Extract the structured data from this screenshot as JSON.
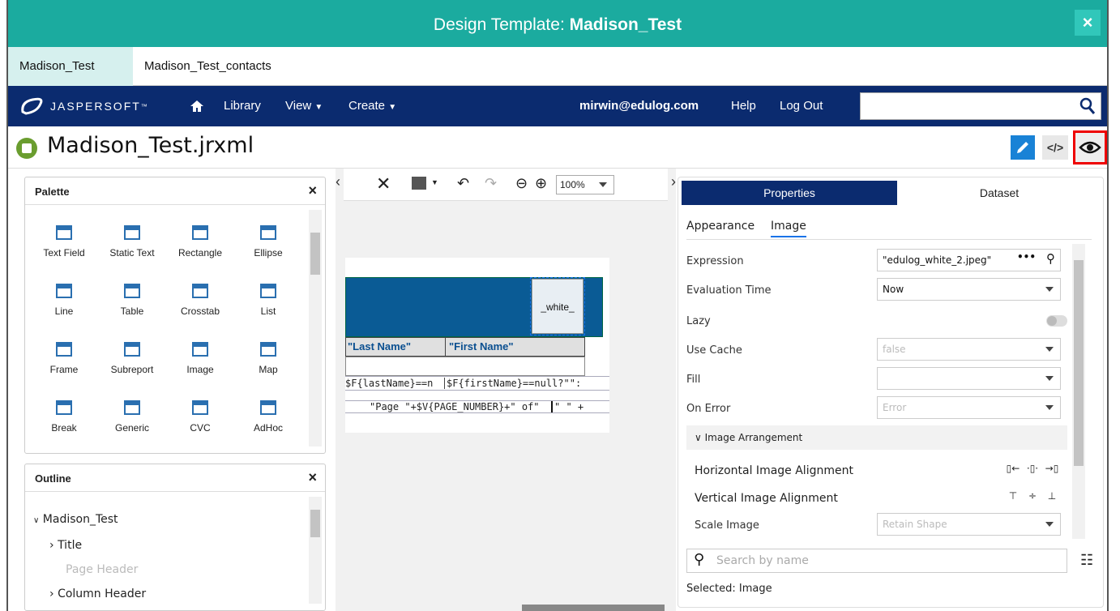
{
  "dialog": {
    "title_prefix": "Design Template: ",
    "title_name": "Madison_Test",
    "close": "×"
  },
  "tabs": [
    {
      "label": "Madison_Test",
      "active": true
    },
    {
      "label": "Madison_Test_contacts",
      "active": false
    }
  ],
  "nav": {
    "logo": "JASPERSOFT",
    "logo_mark": "™",
    "library": "Library",
    "view": "View",
    "create": "Create",
    "user": "mirwin@edulog.com",
    "help": "Help",
    "logout": "Log Out",
    "search_value": ""
  },
  "report": {
    "title": "Madison_Test.jrxml"
  },
  "toolbar": {
    "zoom": "100%"
  },
  "palette": {
    "title": "Palette",
    "close": "×",
    "items": [
      {
        "label": "Text Field",
        "icon": "text-field-icon"
      },
      {
        "label": "Static Text",
        "icon": "static-text-icon"
      },
      {
        "label": "Rectangle",
        "icon": "rectangle-icon"
      },
      {
        "label": "Ellipse",
        "icon": "ellipse-icon"
      },
      {
        "label": "Line",
        "icon": "line-icon"
      },
      {
        "label": "Table",
        "icon": "table-icon"
      },
      {
        "label": "Crosstab",
        "icon": "crosstab-icon"
      },
      {
        "label": "List",
        "icon": "list-icon"
      },
      {
        "label": "Frame",
        "icon": "frame-icon"
      },
      {
        "label": "Subreport",
        "icon": "subreport-icon"
      },
      {
        "label": "Image",
        "icon": "image-icon"
      },
      {
        "label": "Map",
        "icon": "map-icon"
      },
      {
        "label": "Break",
        "icon": "break-icon"
      },
      {
        "label": "Generic",
        "icon": "generic-icon"
      },
      {
        "label": "CVC",
        "icon": "cvc-icon"
      },
      {
        "label": "AdHoc",
        "icon": "adhoc-icon"
      }
    ]
  },
  "outline": {
    "title": "Outline",
    "close": "×",
    "root": "Madison_Test",
    "items": [
      {
        "label": "Title",
        "enabled": true
      },
      {
        "label": "Page Header",
        "enabled": false
      },
      {
        "label": "Column Header",
        "enabled": true
      }
    ]
  },
  "canvas": {
    "image_text": "_white_",
    "col_last": "\"Last Name\"",
    "col_first": "\"First Name\"",
    "detail_last": "$F{lastName}==n",
    "detail_first": "$F{firstName}==null?\"\":",
    "footer": "\"Page \"+$V{PAGE_NUMBER}+\" of\"",
    "footer2": "\" \" +"
  },
  "properties": {
    "tabs": {
      "properties": "Properties",
      "dataset": "Dataset"
    },
    "subtabs": {
      "appearance": "Appearance",
      "image": "Image"
    },
    "rows": [
      {
        "label": "Expression",
        "value": "\"edulog_white_2.jpeg\"",
        "disabled": false
      },
      {
        "label": "Evaluation Time",
        "value": "Now",
        "disabled": false
      },
      {
        "label": "Lazy",
        "value": "",
        "disabled": false
      },
      {
        "label": "Use Cache",
        "value": "false",
        "disabled": true
      },
      {
        "label": "Fill",
        "value": "",
        "disabled": false
      },
      {
        "label": "On Error",
        "value": "Error",
        "disabled": true
      }
    ],
    "section": "Image Arrangement",
    "h_align": "Horizontal Image Alignment",
    "v_align": "Vertical Image Alignment",
    "scale_label": "Scale Image",
    "scale_value": "Retain Shape",
    "search_placeholder": "Search by name",
    "selected": "Selected: Image"
  }
}
